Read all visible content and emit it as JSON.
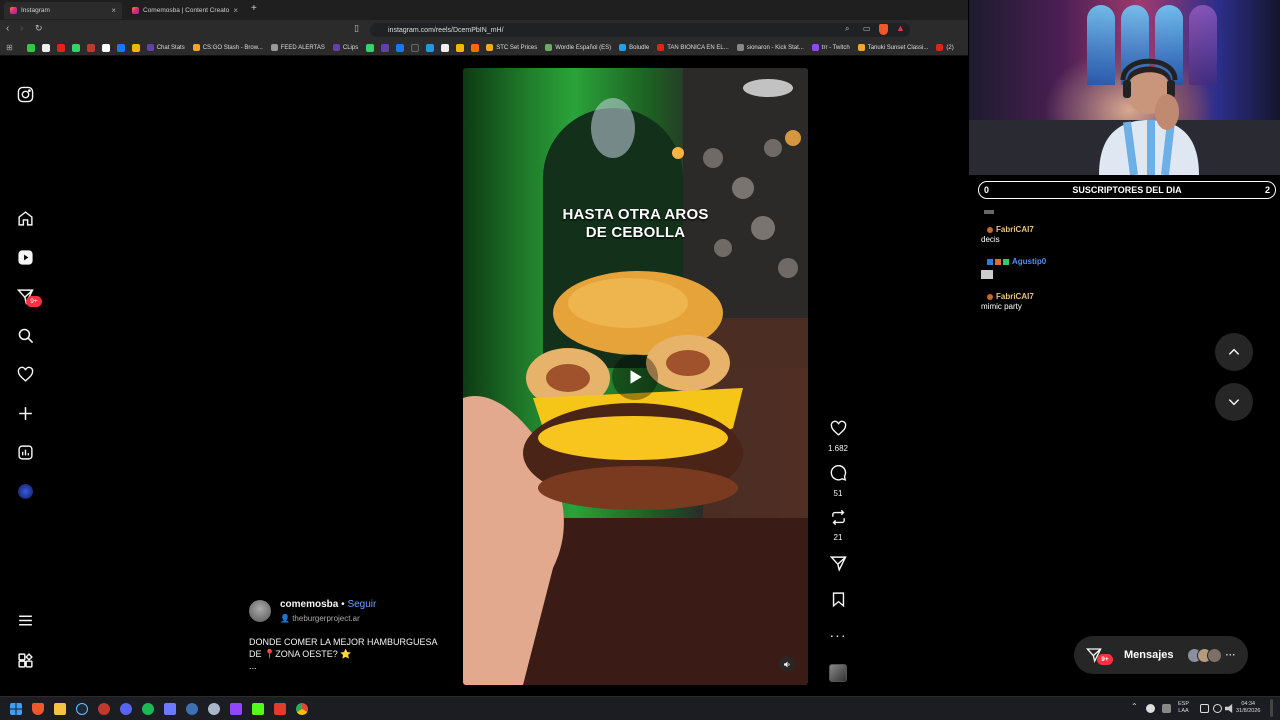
{
  "browser": {
    "tabs": [
      {
        "title": "Instagram",
        "active": true
      },
      {
        "title": "Comemosba | Content Creator |",
        "active": false
      }
    ],
    "url": "instagram.com/reels/DcemPbIN_mH/",
    "bookmarks": [
      "Chat Stats",
      "CS:GO Stash - Brow...",
      "FEED ALERTAS",
      "CLips",
      "STC Set Prices",
      "Wordle Español (ES)",
      "Boludle",
      "TAN BIONICA EN EL...",
      "sionaron - Kick Stat...",
      "trr - Twitch",
      "Tanuki Sunset Classi...",
      "(2)"
    ]
  },
  "sidebar": {
    "notifications_badge": "9+"
  },
  "reel": {
    "caption_line1": "HASTA OTRA AROS",
    "caption_line2": "DE CEBOLLA"
  },
  "actions": {
    "likes": "1.682",
    "comments": "51",
    "reposts": "21"
  },
  "post": {
    "username": "comemosba",
    "separator": "•",
    "follow_label": "Seguir",
    "audio": "theburgerproject.ar",
    "description": "DONDE COMER LA MEJOR HAMBURGUESA DE 📍ZONA OESTE? ⭐",
    "more": "..."
  },
  "stream": {
    "subs_left": "0",
    "subs_title": "SUSCRIPTORES DEL DIA",
    "subs_right": "2",
    "chat": [
      {
        "user": "FabriCAI7",
        "text": "decis",
        "color": "#e8c27a"
      },
      {
        "user": "Agustip0",
        "text": "",
        "color": "#4f8ff7"
      },
      {
        "user": "FabriCAI7",
        "text": "mimic party",
        "color": "#e8c27a"
      }
    ]
  },
  "messages": {
    "label": "Mensajes",
    "badge": "9+"
  },
  "taskbar": {
    "lang_line1": "ESP",
    "lang_line2": "LAA",
    "time": "04:34",
    "date": "31/8/2026"
  }
}
